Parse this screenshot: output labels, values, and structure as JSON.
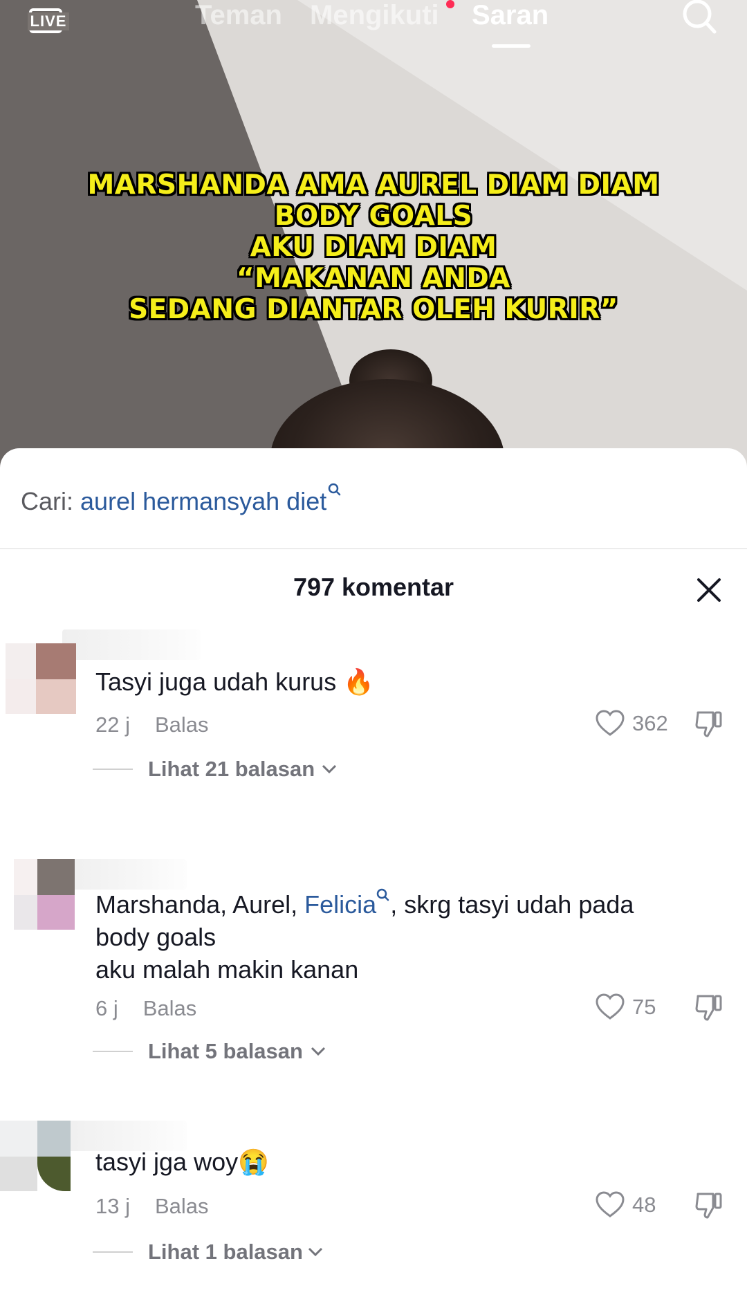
{
  "topnav": {
    "live_label": "LIVE",
    "tabs": [
      "Teman",
      "Mengikuti",
      "Saran"
    ],
    "active_tab": "Saran"
  },
  "video": {
    "caption_lines": [
      "MARSHANDA AMA AUREL DIAM DIAM",
      "BODY GOALS",
      "AKU DIAM DIAM",
      "“MAKANAN ANDA",
      "SEDANG DIANTAR OLEH KURIR”"
    ],
    "caption_color": "#f5ee1a"
  },
  "sheet": {
    "search_label": "Cari:",
    "search_term": "aurel hermansyah diet",
    "comment_count": "797 komentar"
  },
  "comments": [
    {
      "text_parts": [
        "Tasyi juga udah kurus 🔥"
      ],
      "time": "22 j",
      "reply_label": "Balas",
      "likes": "362",
      "view_replies": "Lihat 21 balasan"
    },
    {
      "text_before": "Marshanda, Aurel, ",
      "mention": "Felicia",
      "text_after": ", skrg tasyi udah pada",
      "text_line2": "body goals",
      "text_line3": "aku malah makin kanan",
      "time": "6 j",
      "reply_label": "Balas",
      "likes": "75",
      "view_replies": "Lihat 5 balasan"
    },
    {
      "text_parts": [
        "tasyi jga woy😭"
      ],
      "time": "13 j",
      "reply_label": "Balas",
      "likes": "48",
      "view_replies": "Lihat 1 balasan"
    }
  ],
  "colors": {
    "accent_link": "#2b5a9c",
    "notification_dot": "#fe2c55",
    "muted_text": "#8a8b91"
  }
}
